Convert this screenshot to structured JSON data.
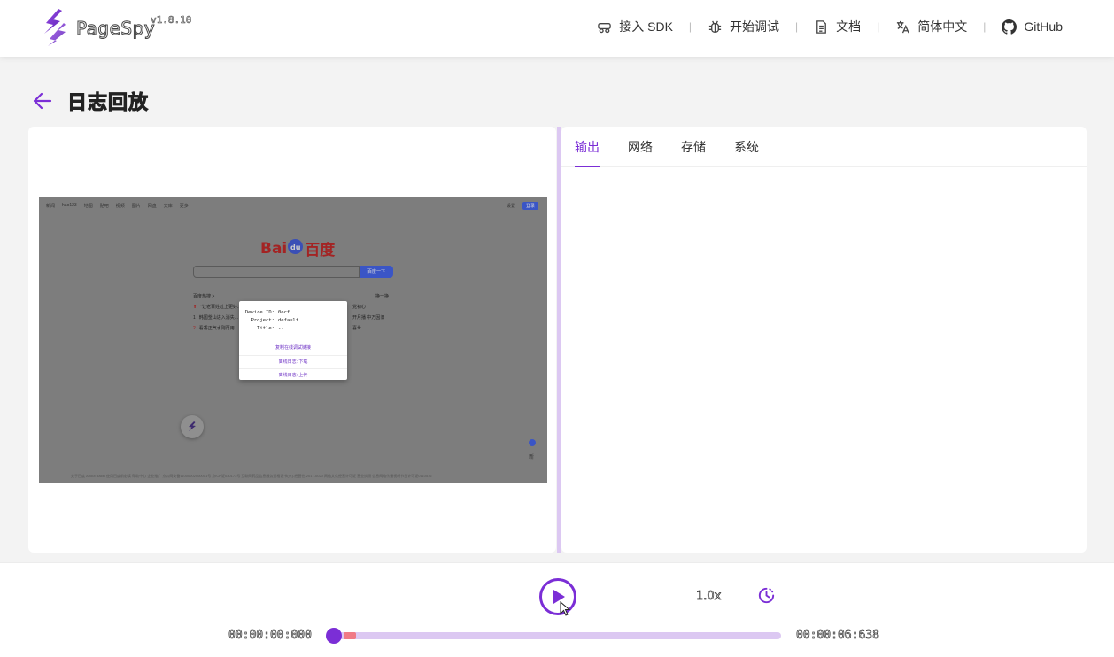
{
  "header": {
    "brand": "PageSpy",
    "version": "v1.8.10",
    "nav": [
      {
        "icon": "sdk-icon",
        "label": "接入 SDK"
      },
      {
        "icon": "debug-icon",
        "label": "开始调试"
      },
      {
        "icon": "doc-icon",
        "label": "文档"
      },
      {
        "icon": "language-icon",
        "label": "简体中文"
      },
      {
        "icon": "github-icon",
        "label": "GitHub"
      }
    ]
  },
  "page": {
    "title": "日志回放"
  },
  "replay": {
    "nav_left": [
      "新闻",
      "hao123",
      "地图",
      "贴吧",
      "视频",
      "图片",
      "网盘",
      "文库",
      "更多"
    ],
    "nav_right": [
      "设置",
      "登录"
    ],
    "logo_text": "Bai",
    "logo_paw": "du",
    "logo_cn": "百度",
    "search_button": "百度一下",
    "hot_title": "百度热搜 >",
    "hot_change": "换一换",
    "hot_rows": [
      {
        "num": "⬆",
        "text": "\"让老百姓过上更好..."
      },
      {
        "num": "1",
        "text": "韩国釜山进入消失..."
      },
      {
        "num": "2",
        "text": "看香正气水则再用..."
      }
    ],
    "hot_right": [
      "党初心",
      "开月播 中万因旧",
      "喜世"
    ],
    "footer": "关于百度   About Baidu   使用百度前必读   帮助中心   企业推广   京公网安备11000002000001号   京ICP证030173号   互联网药品信息服务资格证书(京)-经营性-2017-0020   网络文化经营许可证   营业执照   信息网络传播视听节目许可证0110516",
    "side_label": "新",
    "popup": {
      "rows": [
        {
          "key": "Device ID:",
          "value": "0ocf"
        },
        {
          "key": "Project:",
          "value": "default"
        },
        {
          "key": "Title:",
          "value": "--"
        }
      ],
      "links": [
        "复制在线调试链接",
        "离线日志: 下载",
        "离线日志: 上传"
      ]
    }
  },
  "tabs": [
    "输出",
    "网络",
    "存储",
    "系统"
  ],
  "active_tab": "输出",
  "player": {
    "speed": "1.0x",
    "start_time": "00:00:00:000",
    "end_time": "00:00:06:638",
    "progress": 0
  },
  "colors": {
    "accent": "#7b2ed6",
    "track": "#dcc8f2",
    "marker": "#f07a86"
  }
}
